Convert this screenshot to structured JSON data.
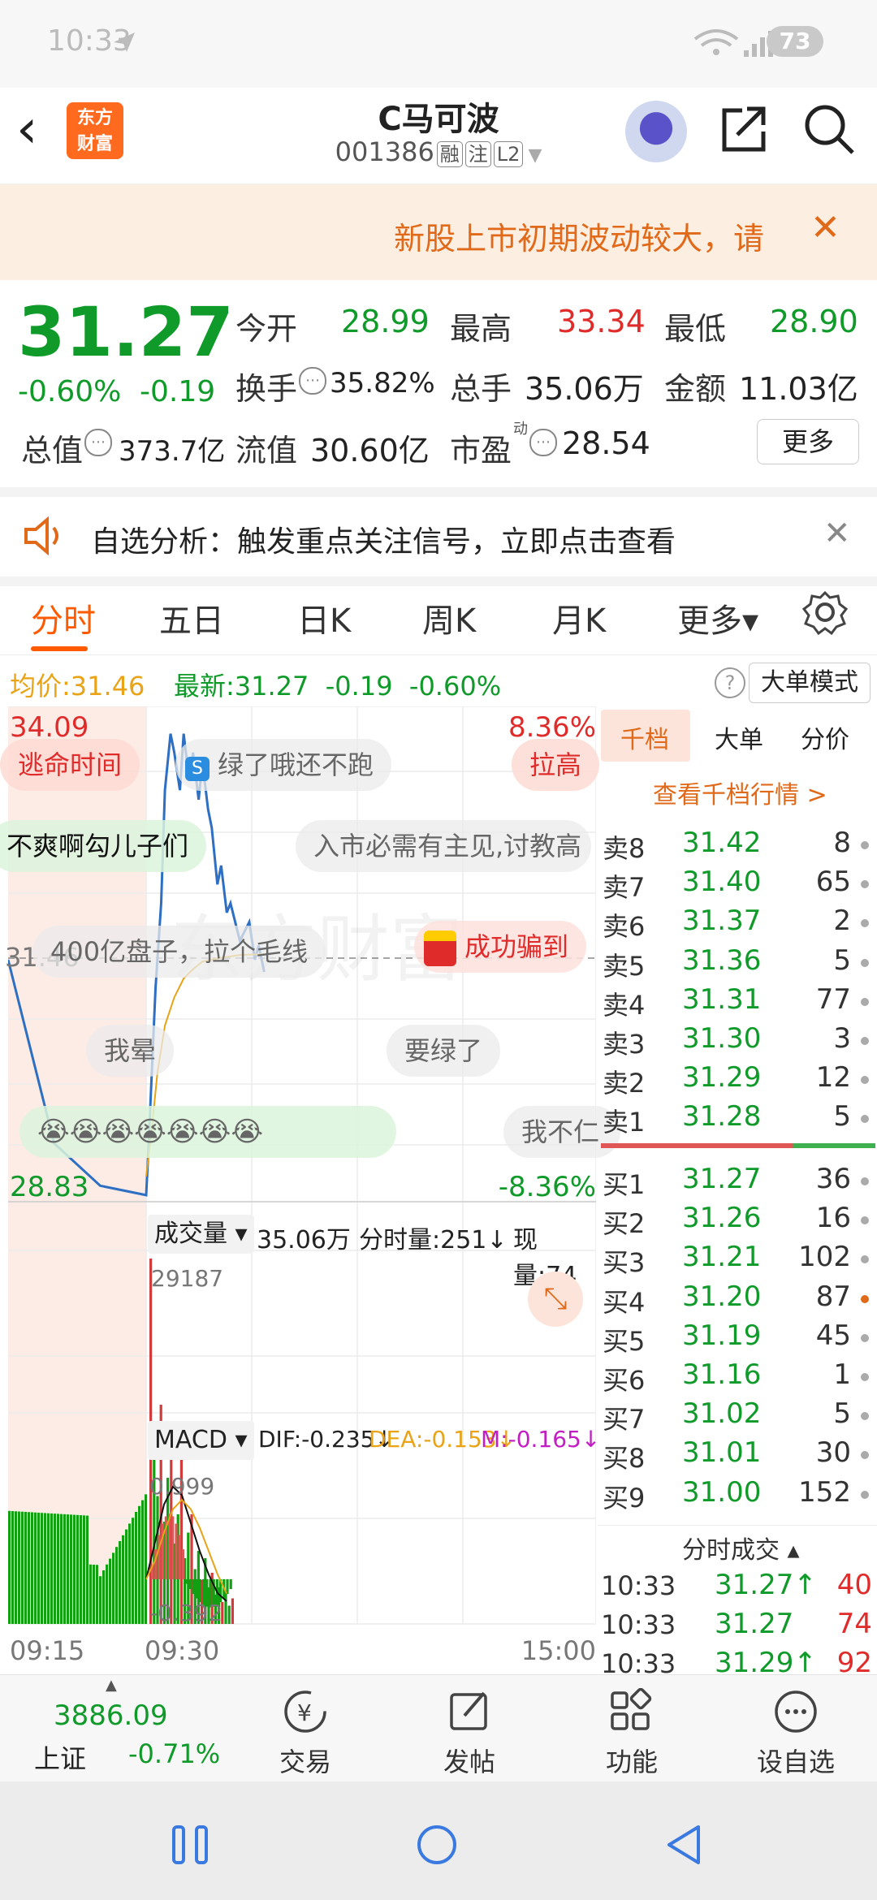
{
  "status": {
    "time": "10:33",
    "battery": "73"
  },
  "header": {
    "back": "‹",
    "logo": "东方\n财富",
    "title": "C马可波",
    "code": "001386",
    "tags": [
      "融",
      "注",
      "L2"
    ]
  },
  "banner": {
    "text": "新股上市初期波动较大，请",
    "close": "✕"
  },
  "quote": {
    "price": "31.27",
    "change_pct": "-0.60%",
    "change_abs": "-0.19",
    "open_label": "今开",
    "open": "28.99",
    "high_label": "最高",
    "high": "33.34",
    "low_label": "最低",
    "low": "28.90",
    "turnover_label": "换手",
    "turnover": "35.82%",
    "volume_label": "总手",
    "volume": "35.06万",
    "amount_label": "金额",
    "amount": "11.03亿",
    "mktcap_label": "总值",
    "mktcap": "373.7亿",
    "float_label": "流值",
    "float": "30.60亿",
    "pe_label": "市盈",
    "pe_sup": "动",
    "pe": "28.54",
    "more": "更多"
  },
  "analysis": {
    "text": "自选分析：触发重点关注信号，立即点击查看",
    "close": "✕"
  },
  "tabs": [
    "分时",
    "五日",
    "日K",
    "周K",
    "月K",
    "更多▾"
  ],
  "info": {
    "avg_label": "均价:",
    "avg": "31.46",
    "latest_label": "最新:",
    "latest": "31.27",
    "chg": "-0.19",
    "pct": "-0.60%",
    "help": "?",
    "bigorder": "大单模式"
  },
  "chart": {
    "high_label": "34.09",
    "low_label": "28.83",
    "up_pct": "8.36%",
    "down_pct": "-8.36%",
    "mid_price": "31.46",
    "volume_selector": "成交量 ▾",
    "volume_total": "35.06万",
    "fenshi_vol": "分时量:251↓",
    "now_vol": "现量:74",
    "vol_max": "29187",
    "macd_selector": "MACD ▾",
    "dif": "DIF:-0.235↓",
    "dea": "DEA:-0.153↓",
    "m": "M:-0.165↓",
    "macd_max": "0.999",
    "macd_min": "-0.392",
    "time_start": "09:15",
    "time_mid": "09:30",
    "time_end": "15:00",
    "danmu": [
      "逃命时间",
      "绿了哦还不跑",
      "拉高",
      "不爽啊勾儿子们",
      "入市必需有主见,讨教高",
      "400亿盘子，拉个毛线",
      "成功骗到",
      "我晕",
      "要绿了",
      "我不仁"
    ],
    "watermark": "东方财富"
  },
  "chart_data": {
    "type": "line",
    "title": "",
    "x_range": [
      "09:15",
      "15:00"
    ],
    "ylim": [
      28.83,
      34.09
    ],
    "reference": 31.46,
    "series": [
      {
        "name": "",
        "x": [
          "09:15",
          "09:20",
          "09:25",
          "09:30",
          "09:31",
          "09:33",
          "09:35",
          "09:38",
          "09:40",
          "09:43",
          "09:45",
          "09:48",
          "09:50",
          "09:53",
          "09:55",
          "09:58",
          "10:00",
          "10:03",
          "10:05",
          "10:08",
          "10:10",
          "10:13",
          "10:15",
          "10:20",
          "10:25",
          "10:28",
          "10:30",
          "10:33"
        ],
        "values": [
          31.4,
          29.45,
          29.0,
          28.9,
          29.3,
          30.2,
          31.1,
          32.0,
          33.2,
          33.8,
          33.6,
          33.2,
          33.8,
          33.3,
          33.6,
          33.1,
          33.5,
          33.0,
          32.8,
          32.2,
          32.4,
          31.9,
          32.0,
          31.6,
          31.8,
          31.4,
          31.55,
          31.27
        ]
      },
      {
        "name": "均价",
        "x": [
          "09:30",
          "09:33",
          "09:36",
          "09:40",
          "09:45",
          "09:50",
          "09:55",
          "10:00",
          "10:10",
          "10:20",
          "10:33"
        ],
        "values": [
          29.1,
          29.6,
          30.2,
          30.7,
          31.0,
          31.2,
          31.3,
          31.38,
          31.42,
          31.45,
          31.46
        ]
      }
    ],
    "volume": {
      "max": 29187,
      "total": "35.06万"
    },
    "macd": {
      "dif": -0.235,
      "dea": -0.153,
      "m": -0.165,
      "range": [
        -0.392,
        0.999
      ]
    }
  },
  "book": {
    "tabs": [
      "千档",
      "大单",
      "分价"
    ],
    "link": "查看千档行情 >",
    "asks": [
      {
        "label": "卖8",
        "price": "31.42",
        "vol": "8"
      },
      {
        "label": "卖7",
        "price": "31.40",
        "vol": "65"
      },
      {
        "label": "卖6",
        "price": "31.37",
        "vol": "2"
      },
      {
        "label": "卖5",
        "price": "31.36",
        "vol": "5"
      },
      {
        "label": "卖4",
        "price": "31.31",
        "vol": "77"
      },
      {
        "label": "卖3",
        "price": "31.30",
        "vol": "3"
      },
      {
        "label": "卖2",
        "price": "31.29",
        "vol": "12"
      },
      {
        "label": "卖1",
        "price": "31.28",
        "vol": "5"
      }
    ],
    "bids": [
      {
        "label": "买1",
        "price": "31.27",
        "vol": "36"
      },
      {
        "label": "买2",
        "price": "31.26",
        "vol": "16"
      },
      {
        "label": "买3",
        "price": "31.21",
        "vol": "102"
      },
      {
        "label": "买4",
        "price": "31.20",
        "vol": "87"
      },
      {
        "label": "买5",
        "price": "31.19",
        "vol": "45"
      },
      {
        "label": "买6",
        "price": "31.16",
        "vol": "1"
      },
      {
        "label": "买7",
        "price": "31.02",
        "vol": "5"
      },
      {
        "label": "买8",
        "price": "31.01",
        "vol": "30"
      },
      {
        "label": "买9",
        "price": "31.00",
        "vol": "152"
      }
    ],
    "trades_label": "分时成交 ▴",
    "trades": [
      {
        "time": "10:33",
        "price": "31.27↑",
        "vol": "40"
      },
      {
        "time": "10:33",
        "price": "31.27",
        "vol": "74"
      },
      {
        "time": "10:33",
        "price": "31.29↑",
        "vol": "92"
      }
    ]
  },
  "bottom": {
    "index_value": "3886.09",
    "index_name": "上证",
    "index_pct": "-0.71%",
    "trade": "交易",
    "post": "发帖",
    "func": "功能",
    "watch": "设自选"
  }
}
